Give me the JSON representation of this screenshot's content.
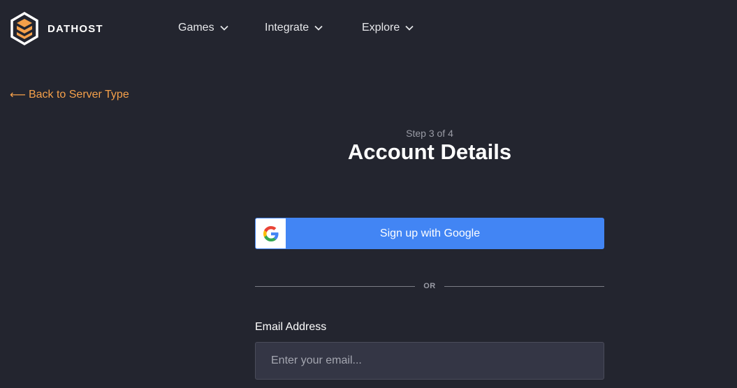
{
  "header": {
    "brand": "DATHOST",
    "brand_color": "#f5a04a",
    "nav": [
      {
        "label": "Games",
        "icon": "chevron-down-icon"
      },
      {
        "label": "Integrate",
        "icon": "chevron-down-icon"
      },
      {
        "label": "Explore",
        "icon": "chevron-down-icon"
      }
    ]
  },
  "back_link": {
    "arrow": "⟵",
    "label": "Back to Server Type",
    "color": "#f5a04a"
  },
  "form": {
    "step": "Step 3 of 4",
    "title": "Account Details",
    "google_button": {
      "label": "Sign up with Google",
      "color": "#4285f4",
      "icon": "google-icon"
    },
    "divider_text": "OR",
    "email": {
      "label": "Email Address",
      "placeholder": "Enter your email...",
      "value": ""
    }
  }
}
